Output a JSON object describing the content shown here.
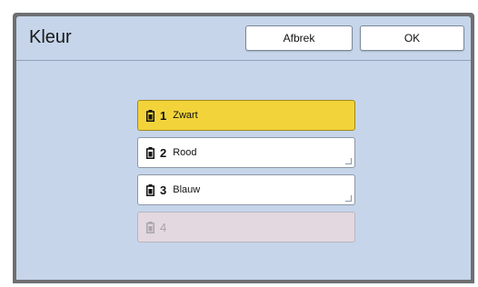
{
  "dialog": {
    "title": "Kleur",
    "cancel_label": "Afbrek",
    "ok_label": "OK"
  },
  "colors": [
    {
      "number": "1",
      "label": "Zwart",
      "state": "selected"
    },
    {
      "number": "2",
      "label": "Rood",
      "state": "normal"
    },
    {
      "number": "3",
      "label": "Blauw",
      "state": "normal"
    },
    {
      "number": "4",
      "label": "",
      "state": "disabled"
    }
  ],
  "theme": {
    "panel": "#c6d5ea",
    "selected": "#f2d43a",
    "disabled": "#e3d8df"
  }
}
